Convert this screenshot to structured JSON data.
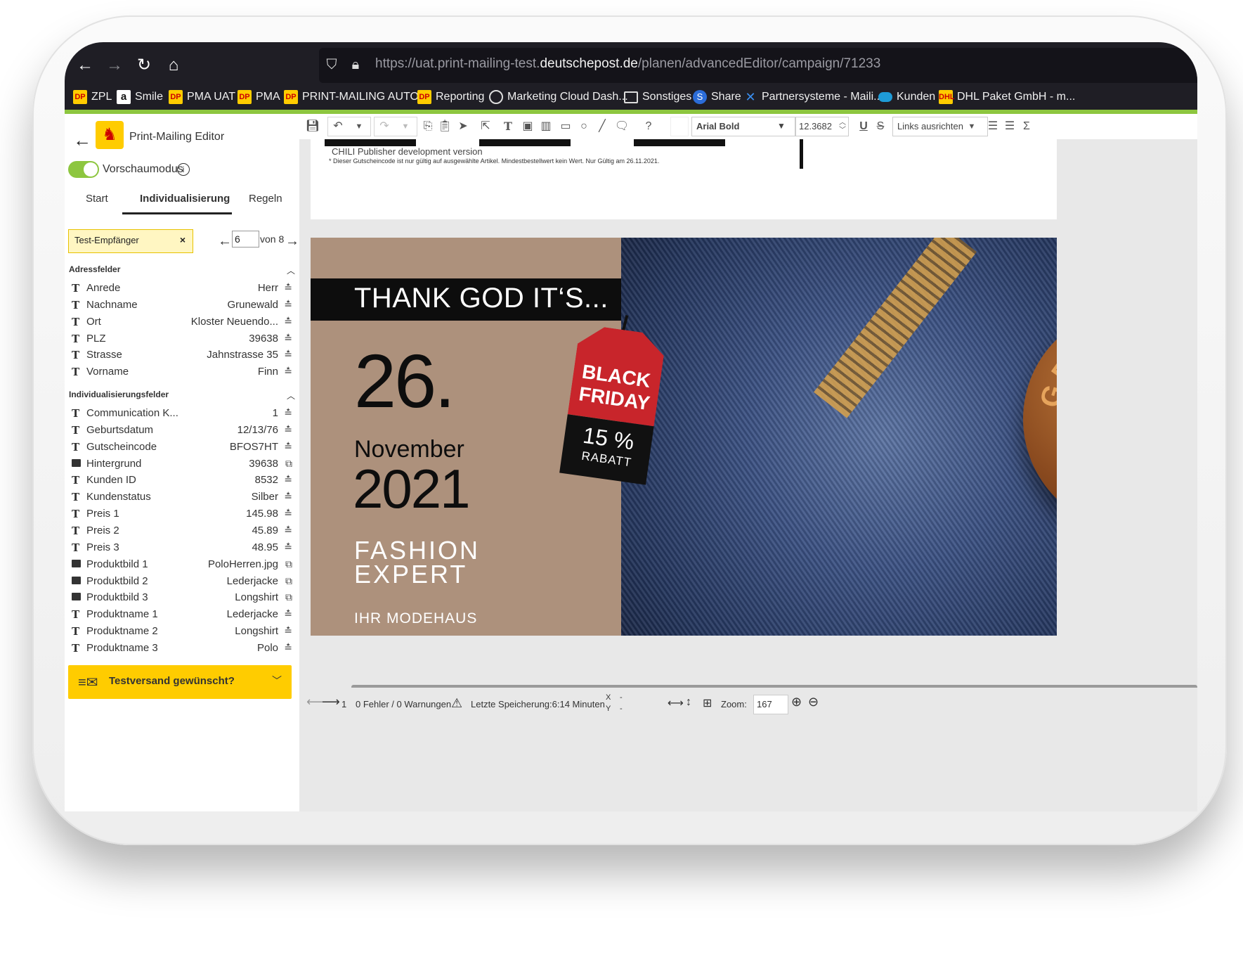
{
  "browser": {
    "url_prefix": "https://uat.print-mailing-test.",
    "url_domain": "deutschepost.de",
    "url_path": "/planen/advancedEditor/campaign/71233",
    "bookmarks": [
      {
        "icon": "dp-logo-icon",
        "label": "ZPL"
      },
      {
        "icon": "amazon-icon",
        "label": "Smile"
      },
      {
        "icon": "dp-logo-icon",
        "label": "PMA UAT"
      },
      {
        "icon": "dp-logo-icon",
        "label": "PMA"
      },
      {
        "icon": "dp-logo-icon",
        "label": "PRINT-MAILING AUTO..."
      },
      {
        "icon": "dp-logo-icon",
        "label": "Reporting"
      },
      {
        "icon": "globe-icon",
        "label": "Marketing Cloud Dash..."
      },
      {
        "icon": "folder-icon",
        "label": "Sonstiges"
      },
      {
        "icon": "sharepoint-icon",
        "label": "Share"
      },
      {
        "icon": "partner-icon",
        "label": "Partnersysteme - Maili..."
      },
      {
        "icon": "cloud-icon",
        "label": "Kunden"
      },
      {
        "icon": "dhl-icon",
        "label": "DHL Paket GmbH - m..."
      }
    ]
  },
  "app": {
    "title": "Print-Mailing Editor",
    "preview_label": "Vorschaumodus",
    "tabs": [
      "Start",
      "Individualisierung",
      "Regeln"
    ],
    "recipient_label": "Test-Empfänger",
    "pager": {
      "current": "6",
      "of_label": "von 8"
    }
  },
  "address_section": {
    "title": "Adressfelder",
    "fields": [
      {
        "type": "T",
        "name": "Anrede",
        "value": "Herr"
      },
      {
        "type": "T",
        "name": "Nachname",
        "value": "Grunewald"
      },
      {
        "type": "T",
        "name": "Ort",
        "value": "Kloster Neuendo..."
      },
      {
        "type": "T",
        "name": "PLZ",
        "value": "39638"
      },
      {
        "type": "T",
        "name": "Strasse",
        "value": "Jahnstrasse 35"
      },
      {
        "type": "T",
        "name": "Vorname",
        "value": "Finn"
      }
    ]
  },
  "indiv_section": {
    "title": "Individualisierungsfelder",
    "fields": [
      {
        "type": "T",
        "name": "Communication K...",
        "value": "1"
      },
      {
        "type": "T",
        "name": "Geburtsdatum",
        "value": "12/13/76"
      },
      {
        "type": "T",
        "name": "Gutscheincode",
        "value": "BFOS7HT"
      },
      {
        "type": "I",
        "name": "Hintergrund",
        "value": "39638"
      },
      {
        "type": "T",
        "name": "Kunden ID",
        "value": "8532"
      },
      {
        "type": "T",
        "name": "Kundenstatus",
        "value": "Silber"
      },
      {
        "type": "T",
        "name": "Preis 1",
        "value": "145.98"
      },
      {
        "type": "T",
        "name": "Preis 2",
        "value": "45.89"
      },
      {
        "type": "T",
        "name": "Preis 3",
        "value": "48.95"
      },
      {
        "type": "I",
        "name": "Produktbild 1",
        "value": "PoloHerren.jpg"
      },
      {
        "type": "I",
        "name": "Produktbild 2",
        "value": "Lederjacke"
      },
      {
        "type": "I",
        "name": "Produktbild 3",
        "value": "Longshirt"
      },
      {
        "type": "T",
        "name": "Produktname 1",
        "value": "Lederjacke"
      },
      {
        "type": "T",
        "name": "Produktname 2",
        "value": "Longshirt"
      },
      {
        "type": "T",
        "name": "Produktname 3",
        "value": "Polo"
      }
    ]
  },
  "testversand_label": "Testversand gewünscht?",
  "toolbar": {
    "font": "Arial Bold",
    "size": "12.3682",
    "align": "Links ausrichten"
  },
  "canvas": {
    "chili_note": "CHILI Publisher development version",
    "fineprint": "* Dieser Gutscheincode ist nur gültig auf ausgewählte Artikel. Mindestbestellwert kein Wert. Nur Gültig am 26.11.2021.",
    "headline": "THANK GOD IT‘S...",
    "day": "26.",
    "month": "November",
    "year": "2021",
    "fashion_line1": "FASHION",
    "fashion_line2": "EXPERT",
    "modehaus": "IHR  MODEHAUS",
    "tag_line1": "BLACK",
    "tag_line2": "FRIDAY",
    "tag_percent": "15 %",
    "tag_rabatt": "RABATT",
    "button_text": "GRUNEWALD FINN"
  },
  "statusbar": {
    "page": "1",
    "errors": "0 Fehler / 0 Warnungen",
    "last_save": "Letzte Speicherung:6:14 Minuten",
    "x_label": "X",
    "x_value": "-",
    "y_label": "Y",
    "y_value": "-",
    "zoom_label": "Zoom:",
    "zoom_value": "167"
  }
}
